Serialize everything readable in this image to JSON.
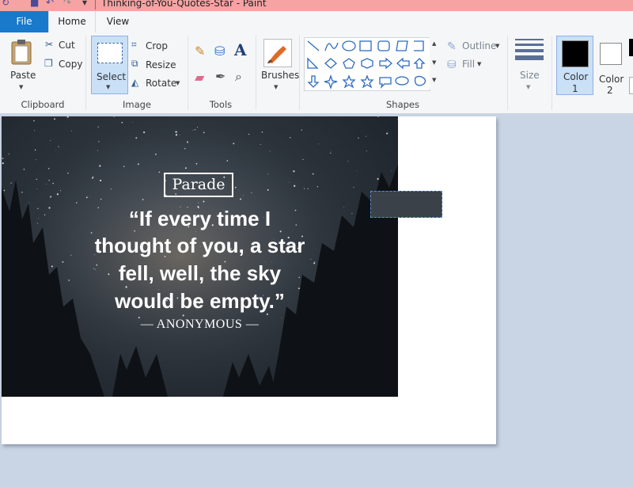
{
  "window": {
    "title": "Thinking-of-You-Quotes-Star - Paint"
  },
  "tabs": [
    {
      "label": "File"
    },
    {
      "label": "Home"
    },
    {
      "label": "View"
    }
  ],
  "ribbon": {
    "clipboard": {
      "paste": "Paste",
      "cut": "Cut",
      "copy": "Copy",
      "group": "Clipboard"
    },
    "image": {
      "select": "Select",
      "crop": "Crop",
      "resize": "Resize",
      "rotate": "Rotate",
      "group": "Image"
    },
    "tools": {
      "group": "Tools"
    },
    "brushes": {
      "label": "Brushes"
    },
    "shapes": {
      "outline": "Outline",
      "fill": "Fill",
      "group": "Shapes"
    },
    "size": {
      "label": "Size"
    },
    "colors": {
      "color1": "Color",
      "color1_num": "1",
      "color2": "Color",
      "color2_num": "2",
      "color1_value": "#000000",
      "color2_value": "#ffffff"
    }
  },
  "image": {
    "badge": "Parade",
    "quote": [
      "“If every time I",
      "thought of you, a star",
      "fell, well, the sky",
      "would be empty.”"
    ],
    "attribution": "— ANONYMOUS —"
  }
}
